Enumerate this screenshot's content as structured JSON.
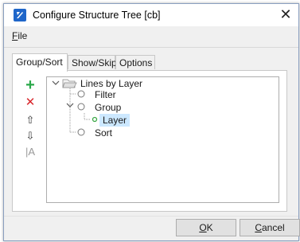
{
  "window": {
    "title": "Configure Structure Tree [cb]",
    "close_glyph": "✕"
  },
  "menu": {
    "file_mnemonic": "F",
    "file_rest": "ile"
  },
  "tabs": [
    {
      "label": "Group/Sort",
      "active": true
    },
    {
      "label": "Show/Skip",
      "active": false
    },
    {
      "label": "Options",
      "active": false
    }
  ],
  "toolbar": {
    "add_glyph": "+",
    "delete_glyph": "✕",
    "up_glyph": "⇧",
    "down_glyph": "⇩",
    "rename_glyph": "|A"
  },
  "tree": {
    "root": {
      "label": "Lines by Layer",
      "expanded": true,
      "icon": "folder-open-icon"
    },
    "children": [
      {
        "label": "Filter"
      },
      {
        "label": "Group",
        "expanded": true,
        "children": [
          {
            "label": "Layer",
            "selected": true
          }
        ]
      },
      {
        "label": "Sort"
      }
    ]
  },
  "buttons": {
    "ok_mnemonic": "O",
    "ok_rest": "K",
    "cancel_mnemonic": "C",
    "cancel_rest": "ancel"
  },
  "colors": {
    "accent": "#1f66c9",
    "add_green": "#2aa84a",
    "delete_red": "#d8262b",
    "selection": "#cce8ff",
    "layer_green": "#3aa845"
  }
}
